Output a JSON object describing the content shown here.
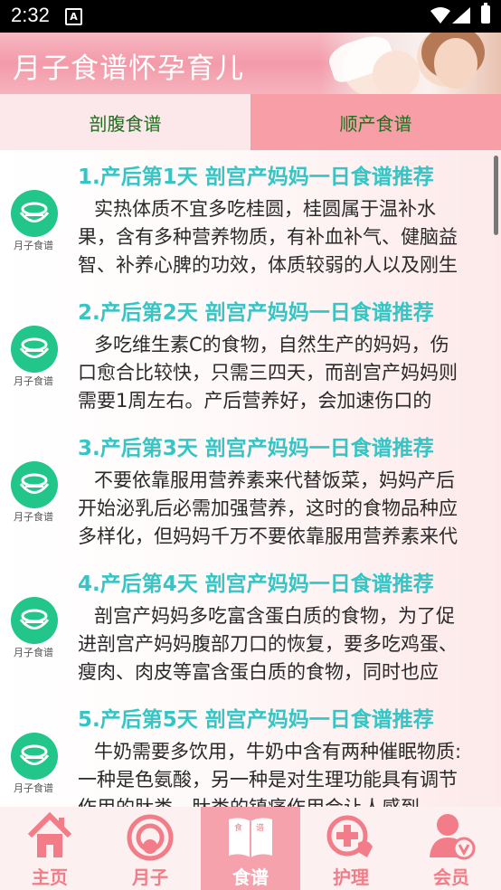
{
  "status_bar": {
    "time": "2:32",
    "notification_icon": "A"
  },
  "header": {
    "title": "月子食谱怀孕育儿"
  },
  "tabs": [
    {
      "label": "剖腹食谱"
    },
    {
      "label": "顺产食谱"
    }
  ],
  "icon_label": "月子食谱",
  "items": [
    {
      "title": "1.产后第1天 剖宫产妈妈一日食谱推荐",
      "lines": [
        "实热体质不宜多吃桂圆，桂圆属于温补水",
        "果，含有多种营养物质，有补血补气、健脑益",
        "智、补养心脾的功效，体质较弱的人以及刚生"
      ]
    },
    {
      "title": "2.产后第2天 剖宫产妈妈一日食谱推荐",
      "lines": [
        "多吃维生素C的食物，自然生产的妈妈，伤",
        "口愈合比较快，只需三四天，而剖宫产妈妈则",
        "需要1周左右。产后营养好，会加速伤口的"
      ]
    },
    {
      "title": "3.产后第3天 剖宫产妈妈一日食谱推荐",
      "lines": [
        "不要依靠服用营养素来代替饭菜，妈妈产后",
        "开始泌乳后必需加强营养，这时的食物品种应",
        "多样化，但妈妈千万不要依靠服用营养素来代"
      ]
    },
    {
      "title": "4.产后第4天 剖宫产妈妈一日食谱推荐",
      "lines": [
        "剖宫产妈妈多吃富含蛋白质的食物，为了促",
        "进剖宫产妈妈腹部刀口的恢复，要多吃鸡蛋、",
        "瘦肉、肉皮等富含蛋白质的食物，同时也应"
      ]
    },
    {
      "title": "5.产后第5天 剖宫产妈妈一日食谱推荐",
      "lines": [
        "牛奶需要多饮用，牛奶中含有两种催眠物质:",
        "一种是色氨酸，另一种是对生理功能具有调节",
        "作用的肽类。肽类的镇痛作用会让人感到"
      ]
    }
  ],
  "bottom_nav": [
    {
      "label": "主页",
      "icon": "home-icon"
    },
    {
      "label": "月子",
      "icon": "moon-ring-icon"
    },
    {
      "label": "食谱",
      "icon": "recipe-book-icon",
      "active": true
    },
    {
      "label": "护理",
      "icon": "care-plus-icon"
    },
    {
      "label": "会员",
      "icon": "member-icon"
    }
  ],
  "colors": {
    "accent_pink": "#f79ea6",
    "title_teal": "#36c4c4",
    "icon_green": "#22c58a",
    "tab_text": "#1e6f1e"
  }
}
